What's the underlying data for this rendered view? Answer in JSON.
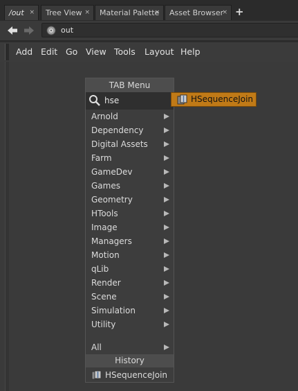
{
  "tabs": [
    {
      "label": "/out",
      "active": true
    },
    {
      "label": "Tree View",
      "active": false
    },
    {
      "label": "Material Palette",
      "active": false
    },
    {
      "label": "Asset Browser",
      "active": false
    }
  ],
  "tab_close": "×",
  "tab_add": "+",
  "path": {
    "value": "out"
  },
  "menubar": [
    "Add",
    "Edit",
    "Go",
    "View",
    "Tools",
    "Layout",
    "Help"
  ],
  "tab_menu": {
    "title": "TAB Menu",
    "search_value": "hse",
    "categories": [
      "Arnold",
      "Dependency",
      "Digital Assets",
      "Farm",
      "GameDev",
      "Games",
      "Geometry",
      "HTools",
      "Image",
      "Managers",
      "Motion",
      "qLib",
      "Render",
      "Scene",
      "Simulation",
      "Utility"
    ],
    "all_label": "All",
    "history_title": "History",
    "history_items": [
      "HSequenceJoin"
    ]
  },
  "search_result": {
    "label": "HSequenceJoin"
  },
  "colors": {
    "accent": "#c07a17",
    "background": "#3a3a3a"
  },
  "icons": {
    "back": "back-arrow-icon",
    "forward": "forward-arrow-icon",
    "network": "network-context-icon",
    "search": "magnifier-icon",
    "node": "node-asset-icon"
  }
}
